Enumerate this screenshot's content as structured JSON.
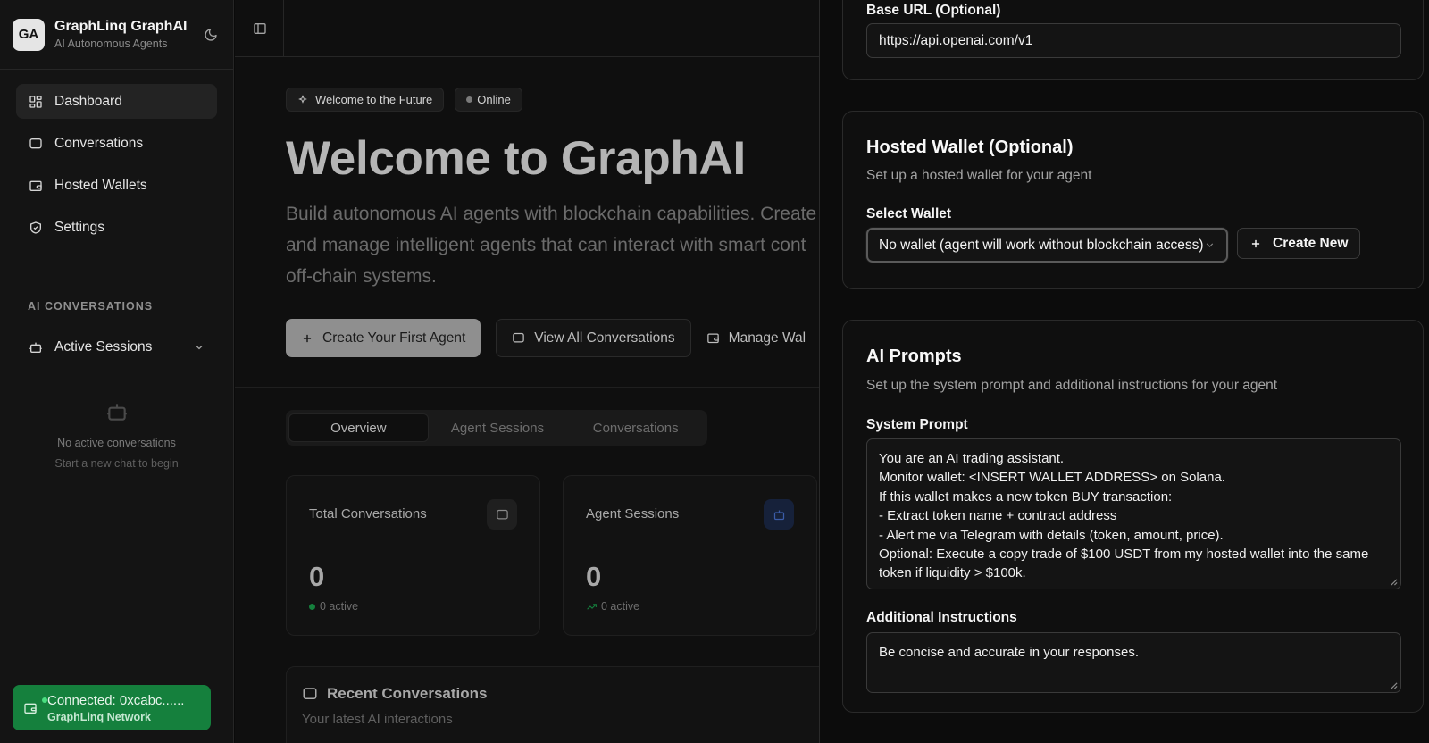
{
  "sidebar": {
    "avatar": "GA",
    "title": "GraphLinq GraphAI",
    "subtitle": "AI Autonomous Agents",
    "nav": [
      {
        "label": "Dashboard"
      },
      {
        "label": "Conversations"
      },
      {
        "label": "Hosted Wallets"
      },
      {
        "label": "Settings"
      }
    ],
    "section_label": "AI CONVERSATIONS",
    "sessions_label": "Active Sessions",
    "empty_title": "No active conversations",
    "empty_sub": "Start a new chat to begin",
    "wallet_status": "Connected: 0xcabc......",
    "wallet_network": "GraphLinq Network",
    "status_color": "#15803d"
  },
  "main": {
    "chip_welcome": "Welcome to the Future",
    "chip_online": "Online",
    "title": "Welcome to GraphAI",
    "desc_lines": [
      "Build autonomous AI agents with blockchain capabilities. Create",
      "and manage intelligent agents that can interact with smart cont",
      "off-chain systems."
    ],
    "btn_create": "Create Your First Agent",
    "btn_view": "View All Conversations",
    "btn_manage": "Manage Wal",
    "tabs": [
      "Overview",
      "Agent Sessions",
      "Conversations"
    ],
    "cards": [
      {
        "title": "Total Conversations",
        "value": "0",
        "sub": "0 active"
      },
      {
        "title": "Agent Sessions",
        "value": "0",
        "sub": "0 active"
      }
    ],
    "recent_title": "Recent Conversations",
    "recent_sub": "Your latest AI interactions"
  },
  "panel": {
    "base_url_label": "Base URL (Optional)",
    "base_url_value": "https://api.openai.com/v1",
    "wallet_title": "Hosted Wallet (Optional)",
    "wallet_desc": "Set up a hosted wallet for your agent",
    "select_label": "Select Wallet",
    "select_value": "No wallet (agent will work without blockchain access)",
    "create_new": "Create New",
    "prompts_title": "AI Prompts",
    "prompts_desc": "Set up the system prompt and additional instructions for your agent",
    "system_label": "System Prompt",
    "system_lines": [
      "You are an AI trading assistant.",
      "Monitor wallet: <INSERT WALLET ADDRESS> on Solana.",
      "If this wallet makes a new token BUY transaction:",
      "- Extract token name + contract address",
      "- Alert me via Telegram with details (token, amount, price).",
      "Optional: Execute a copy trade of $100 USDT from my hosted wallet into the same",
      "token if liquidity > $100k."
    ],
    "additional_label": "Additional Instructions",
    "additional_value": "Be concise and accurate in your responses."
  }
}
